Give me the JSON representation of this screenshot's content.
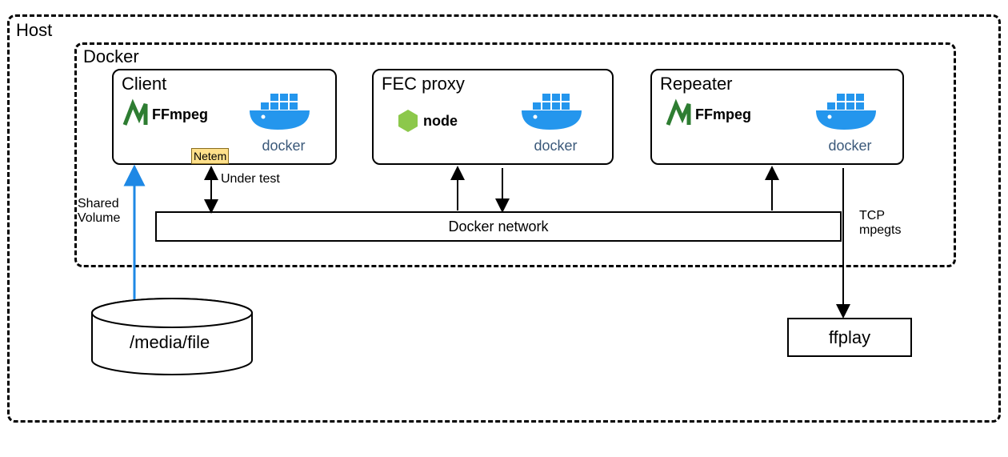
{
  "host": {
    "label": "Host"
  },
  "docker_env": {
    "label": "Docker"
  },
  "client": {
    "label": "Client",
    "ffmpeg_label": "FFmpeg",
    "docker_label": "docker",
    "netem_label": "Netem",
    "under_test_label": "Under test"
  },
  "fec_proxy": {
    "label": "FEC proxy",
    "nodejs_label": "node",
    "docker_label": "docker"
  },
  "repeater": {
    "label": "Repeater",
    "ffmpeg_label": "FFmpeg",
    "docker_label": "docker"
  },
  "docker_network": {
    "label": "Docker network"
  },
  "media_file": {
    "label": "/media/file"
  },
  "shared_volume": {
    "label_line1": "Shared",
    "label_line2": "Volume"
  },
  "ffplay": {
    "label": "ffplay"
  },
  "tcp_mpegts": {
    "label_line1": "TCP",
    "label_line2": "mpegts"
  }
}
